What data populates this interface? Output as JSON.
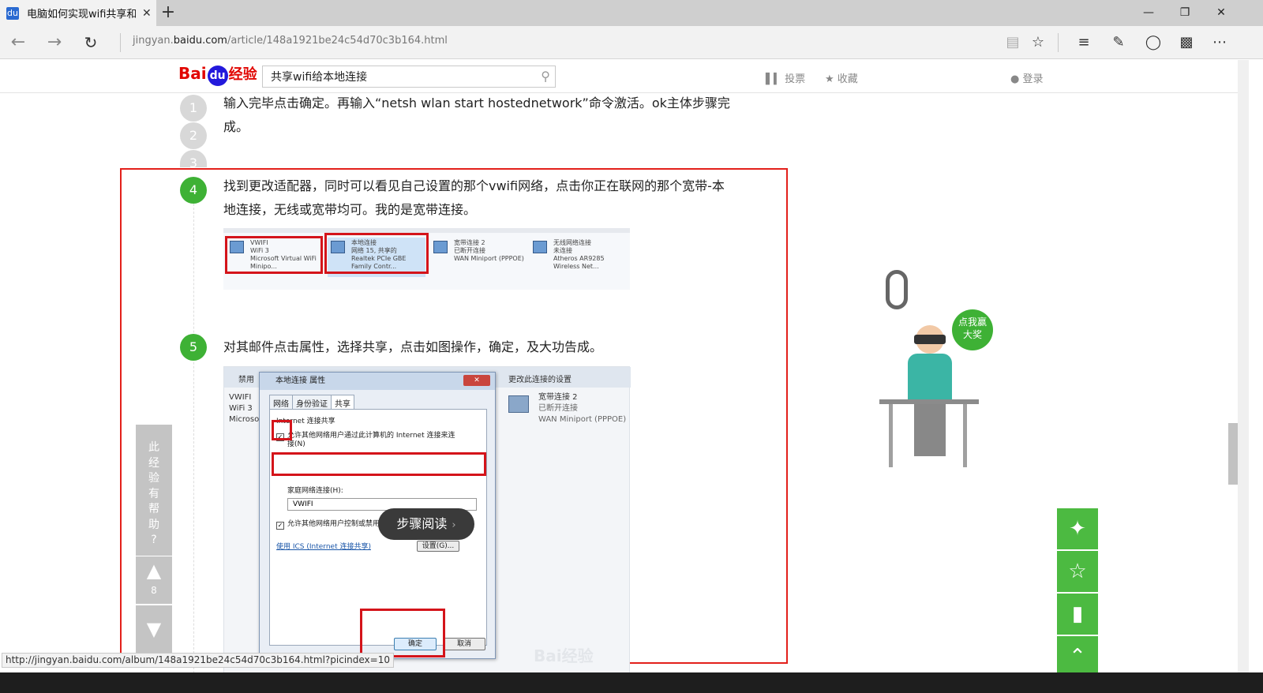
{
  "browser": {
    "tab_title": "电脑如何实现wifi共享和",
    "tab_favicon": "du",
    "tab_close": "✕",
    "new_tab": "+",
    "url_prefix": "jingyan.",
    "url_domain": "baidu.com",
    "url_path": "/article/148a1921be24c54d70c3b164.html",
    "status_url": "http://jingyan.baidu.com/album/148a1921be24c54d70c3b164.html?picindex=10"
  },
  "site": {
    "logo_bai": "Bai",
    "logo_du": "du",
    "logo_jy": "经验",
    "search_value": "共享wifi给本地连接",
    "nav_vote": "投票",
    "nav_fav": "收藏",
    "nav_login": "登录"
  },
  "steps": {
    "s1": "1",
    "s2": "2",
    "s3": "3",
    "s4": "4",
    "s5": "5",
    "text_top": "输入完毕点击确定。再输入“netsh wlan start hostednetwork”命令激活。ok主体步骤完成。",
    "text4": "找到更改适配器，同时可以看见自己设置的那个vwifi网络，点击你正在联网的那个宽带-本地连接，无线或宽带均可。我的是宽带连接。",
    "text5": "对其邮件点击属性，选择共享，点击如图操作，确定，及大功告成。"
  },
  "shot1": {
    "items": [
      {
        "name": "VWIFI",
        "l2": "WiFi 3",
        "l3": "Microsoft Virtual WiFi Minipo..."
      },
      {
        "name": "本地连接",
        "l2": "网络 15, 共享的",
        "l3": "Realtek PCIe GBE Family Contr..."
      },
      {
        "name": "宽带连接 2",
        "l2": "已断开连接",
        "l3": "WAN Miniport (PPPOE)"
      },
      {
        "name": "无线网络连接",
        "l2": "未连接",
        "l3": "Atheros AR9285 Wireless Net..."
      }
    ]
  },
  "shot2": {
    "bar_left": "禁用",
    "bar_right": "更改此连接的设置",
    "left_lines": [
      "VWIFI",
      "WiFi 3",
      "Microso"
    ],
    "right_name": "宽带连接 2",
    "right_l2": "已断开连接",
    "right_l3": "WAN Miniport (PPPOE)",
    "dialog_title": "本地连接 属性",
    "dialog_close": "✕",
    "tabs": [
      "网络",
      "身份验证",
      "共享"
    ],
    "group_label": "Internet 连接共享",
    "check1": "允许其他网络用户通过此计算机的 Internet 连接来连接(N)",
    "home_label": "家庭网络连接(H):",
    "field_value": "VWIFI",
    "check2": "允许其他网络用户控制或禁用共享的 Internet 连接(O)",
    "ics_link": "使用 ICS (Internet 连接共享)",
    "settings_btn": "设置(G)...",
    "ok_btn": "确定",
    "cancel_btn": "取消",
    "watermark": "Bai经验"
  },
  "overlay": {
    "step_read": "步骤阅读",
    "helpful_chars": [
      "此",
      "经",
      "验",
      "有",
      "帮",
      "助",
      "?"
    ],
    "like_count": "8",
    "promo_text": "点我赢大奖"
  },
  "icons": {
    "back": "back-arrow-icon",
    "forward": "forward-arrow-icon",
    "refresh": "refresh-icon",
    "reading": "reading-view-icon",
    "favorite": "star-icon",
    "hub": "hub-icon",
    "note": "web-note-icon",
    "share": "share-icon",
    "more": "more-icon"
  },
  "colors": {
    "green": "#3eb135",
    "red": "#e3201b",
    "baidu_blue": "#2319dc"
  }
}
